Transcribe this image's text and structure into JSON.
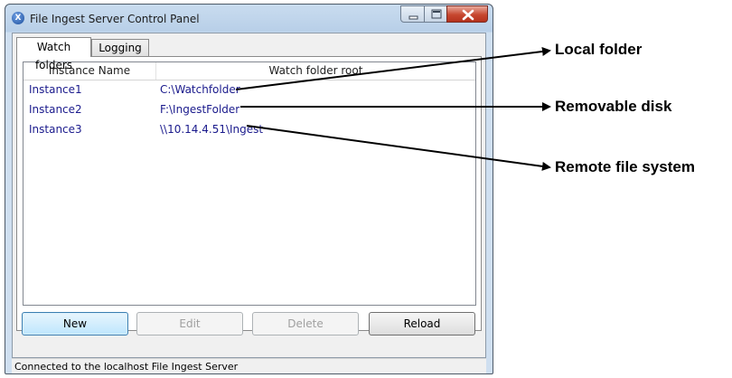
{
  "window": {
    "title": "File Ingest Server Control Panel",
    "app_icon": "X"
  },
  "tabs": [
    {
      "label": "Watch folders",
      "active": true
    },
    {
      "label": "Logging",
      "active": false
    }
  ],
  "table": {
    "columns": [
      "Instance Name",
      "Watch folder root"
    ],
    "rows": [
      {
        "name": "Instance1",
        "root": "C:\\Watchfolder"
      },
      {
        "name": "Instance2",
        "root": "F:\\IngestFolder"
      },
      {
        "name": "Instance3",
        "root": "\\\\10.14.4.51\\Ingest"
      }
    ]
  },
  "buttons": {
    "new": {
      "label": "New",
      "enabled": true
    },
    "edit": {
      "label": "Edit",
      "enabled": false
    },
    "delete": {
      "label": "Delete",
      "enabled": false
    },
    "reload": {
      "label": "Reload",
      "enabled": true
    }
  },
  "status_bar": {
    "text": "Connected to the localhost File Ingest Server"
  },
  "callouts": [
    {
      "label": "Local folder"
    },
    {
      "label": "Removable disk"
    },
    {
      "label": "Remote file system"
    }
  ],
  "colors": {
    "row_text": "#1a1a8c",
    "close_button": "#c7472f",
    "default_button_border": "#3c7fb1"
  }
}
